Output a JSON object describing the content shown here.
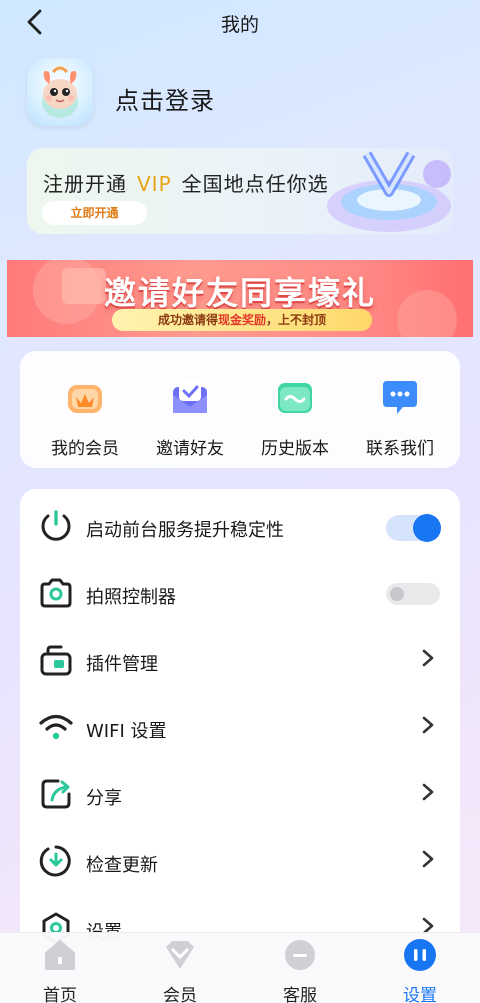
{
  "header": {
    "title": "我的"
  },
  "profile": {
    "login_label": "点击登录"
  },
  "vip_banner": {
    "prefix": "注册开通",
    "vip": "VIP",
    "suffix": "全国地点任你选",
    "button_label": "立即开通"
  },
  "invite_banner": {
    "title": "邀请好友同享壕礼",
    "sub_before": "成功邀请得",
    "sub_highlight": "现金奖励",
    "sub_after": "，上不封顶"
  },
  "quick_actions": [
    {
      "label": "我的会员",
      "icon": "crown-icon"
    },
    {
      "label": "邀请好友",
      "icon": "envelope-check-icon"
    },
    {
      "label": "历史版本",
      "icon": "history-card-icon"
    },
    {
      "label": "联系我们",
      "icon": "chat-bubble-icon"
    }
  ],
  "settings": [
    {
      "label": "启动前台服务提升稳定性",
      "icon": "power-icon",
      "control": "toggle",
      "state": "on"
    },
    {
      "label": "拍照控制器",
      "icon": "camera-icon",
      "control": "toggle",
      "state": "off"
    },
    {
      "label": "插件管理",
      "icon": "plugin-icon",
      "control": "chevron"
    },
    {
      "label": "WIFI 设置",
      "icon": "wifi-icon",
      "control": "chevron"
    },
    {
      "label": "分享",
      "icon": "share-icon",
      "control": "chevron"
    },
    {
      "label": "检查更新",
      "icon": "update-icon",
      "control": "chevron"
    },
    {
      "label": "设置",
      "icon": "settings-icon",
      "control": "chevron"
    }
  ],
  "bottom_nav": [
    {
      "label": "首页",
      "icon": "home-icon",
      "active": false
    },
    {
      "label": "会员",
      "icon": "member-icon",
      "active": false
    },
    {
      "label": "客服",
      "icon": "service-icon",
      "active": false
    },
    {
      "label": "设置",
      "icon": "settings-tab-icon",
      "active": true
    }
  ],
  "colors": {
    "accent": "#1976f3",
    "vip": "#e8a316",
    "banner_red": "#ff7a7a"
  }
}
